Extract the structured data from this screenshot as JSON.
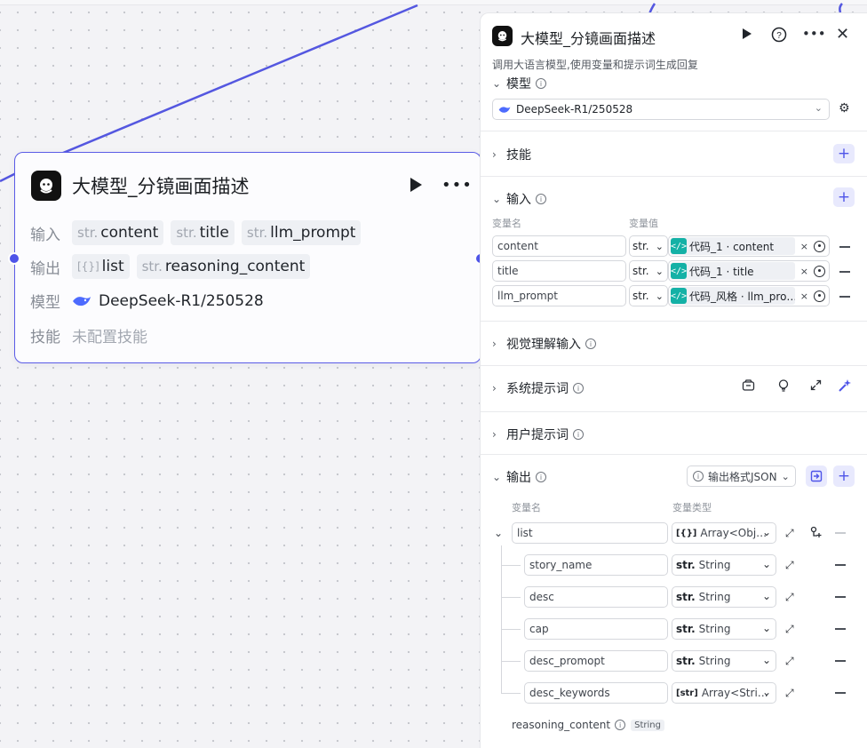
{
  "node": {
    "title": "大模型_分镜画面描述",
    "input_label": "输入",
    "inputs": [
      {
        "type": "str.",
        "name": "content"
      },
      {
        "type": "str.",
        "name": "title"
      },
      {
        "type": "str.",
        "name": "llm_prompt"
      }
    ],
    "output_label": "输出",
    "outputs": [
      {
        "type": "[{}]",
        "name": "list"
      },
      {
        "type": "str.",
        "name": "reasoning_content"
      }
    ],
    "model_label": "模型",
    "model_value": "DeepSeek-R1/250528",
    "skill_label": "技能",
    "skill_value": "未配置技能"
  },
  "panel": {
    "title": "大模型_分镜画面描述",
    "description": "调用大语言模型,使用变量和提示词生成回复",
    "model_section": "模型",
    "model_select": "DeepSeek-R1/250528",
    "skill_section": "技能",
    "input_section": "输入",
    "input_col_name": "变量名",
    "input_col_value": "变量值",
    "inputs": [
      {
        "name": "content",
        "type": "str.",
        "ref": "代码_1 · content"
      },
      {
        "name": "title",
        "type": "str.",
        "ref": "代码_1 · title"
      },
      {
        "name": "llm_prompt",
        "type": "str.",
        "ref": "代码_风格 · llm_pro…"
      }
    ],
    "visual_section": "视觉理解输入",
    "system_prompt_section": "系统提示词",
    "user_prompt_section": "用户提示词",
    "output_section": "输出",
    "output_format_button": "输出格式JSON",
    "output_col_name": "变量名",
    "output_col_type": "变量类型",
    "outputs": [
      {
        "name": "list",
        "type_icon": "[{}]",
        "type": "Array<Obj…"
      },
      {
        "name": "story_name",
        "type_icon": "str.",
        "type": "String"
      },
      {
        "name": "desc",
        "type_icon": "str.",
        "type": "String"
      },
      {
        "name": "cap",
        "type_icon": "str.",
        "type": "String"
      },
      {
        "name": "desc_promopt",
        "type_icon": "str.",
        "type": "String"
      },
      {
        "name": "desc_keywords",
        "type_icon": "[str]",
        "type": "Array<Stri…"
      }
    ],
    "reasoning_name": "reasoning_content",
    "reasoning_type": "String"
  },
  "colors": {
    "accent": "#4e54e8",
    "edge": "#5457e0",
    "code_icon": "#14b1a6"
  }
}
